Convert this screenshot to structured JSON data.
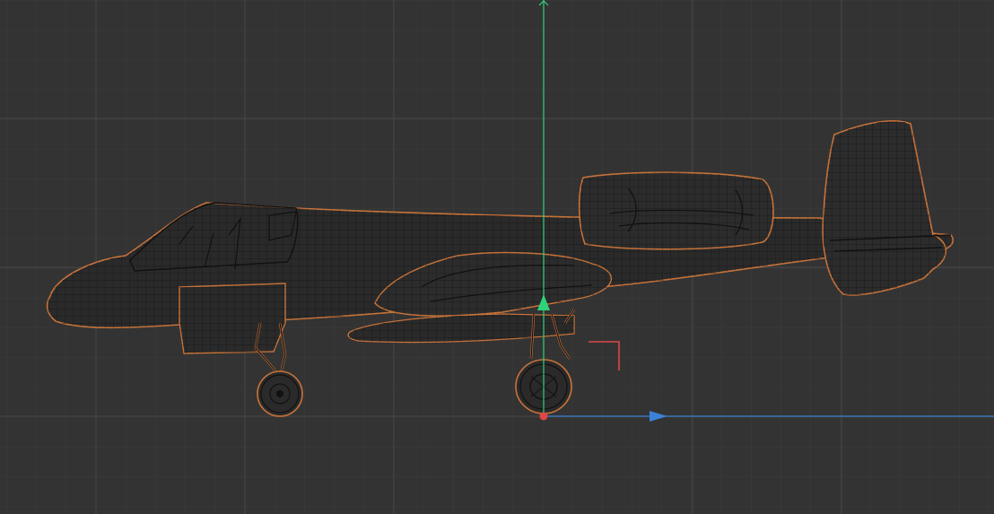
{
  "viewport": {
    "view": "side-orthographic",
    "background_color": "#333333",
    "grid_minor_color": "#3c3c3c",
    "grid_major_color": "#454545",
    "selection_outline_color": "#c8733a",
    "wire_color": "#1a1a1a",
    "object": {
      "name": "aircraft-wireframe",
      "state": "selected"
    },
    "gizmo": {
      "axis_y_color": "#2fd27a",
      "axis_z_color": "#3b82d8",
      "origin_color": "#e04646",
      "plane_handle_color": "#e04646"
    }
  }
}
